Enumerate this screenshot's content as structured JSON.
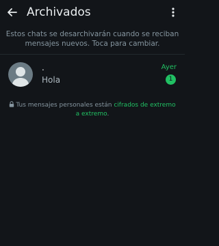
{
  "header": {
    "title": "Archivados"
  },
  "notice": {
    "text": "Estos chats se desarchivarán cuando se reciban mensajes nuevos. Toca para cambiar."
  },
  "chats": [
    {
      "name": ".",
      "last_message": "Hola",
      "time": "Ayer",
      "unread_count": "1"
    }
  ],
  "encryption": {
    "prefix": "Tus mensajes personales están ",
    "link": "cifrados de extremo a extremo",
    "suffix": "."
  },
  "colors": {
    "background": "#121519",
    "accent": "#21c063",
    "secondary_text": "#8696a0"
  }
}
